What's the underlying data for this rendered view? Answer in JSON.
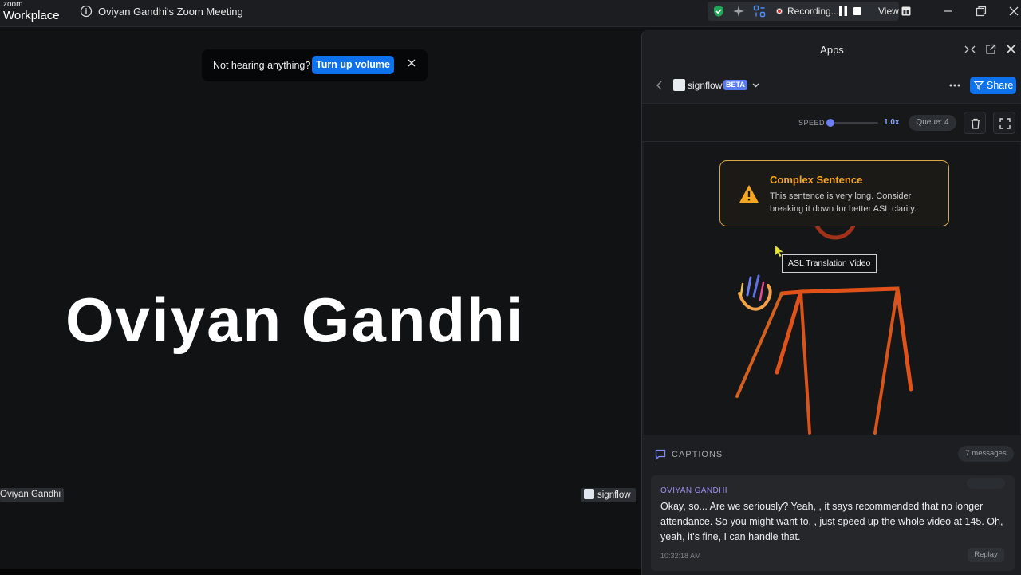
{
  "titlebar": {
    "logo_top": "zoom",
    "logo_bottom": "Workplace",
    "meeting_title": "Oviyan Gandhi's Zoom Meeting",
    "recording_label": "Recording...",
    "view_label": "View"
  },
  "stage": {
    "toast_text": "Not hearing anything?",
    "toast_button": "Turn up volume",
    "participant_name": "Oviyan Gandhi",
    "name_tag": "Oviyan Gandhi",
    "app_tag": "signflow"
  },
  "panel": {
    "title": "Apps",
    "app_name": "signflow",
    "beta_badge": "BETA",
    "share_label": "Share",
    "speed_label": "SPEED",
    "speed_value": "1.0x",
    "speed_level": 0.0,
    "queue_label": "Queue: 4",
    "alert": {
      "title": "Complex Sentence",
      "body": "This sentence is very long. Consider breaking it down for better ASL clarity."
    },
    "tooltip": "ASL Translation Video",
    "captions": {
      "label": "CAPTIONS",
      "count": "7 messages",
      "speaker": "OVIYAN GANDHI",
      "text": "Okay, so... Are we seriously? Yeah, , it says recommended that no longer attendance. So you might want to, , just speed up the whole video at 145. Oh, yeah, it's fine, I can handle that.",
      "timestamp": "10:32:18 AM",
      "replay": "Replay"
    }
  },
  "colors": {
    "accent_blue": "#0e72ed",
    "alert_orange": "#f5a623",
    "speaker_purple": "#9d8ef0",
    "skeleton_orange": "#e0521a"
  }
}
